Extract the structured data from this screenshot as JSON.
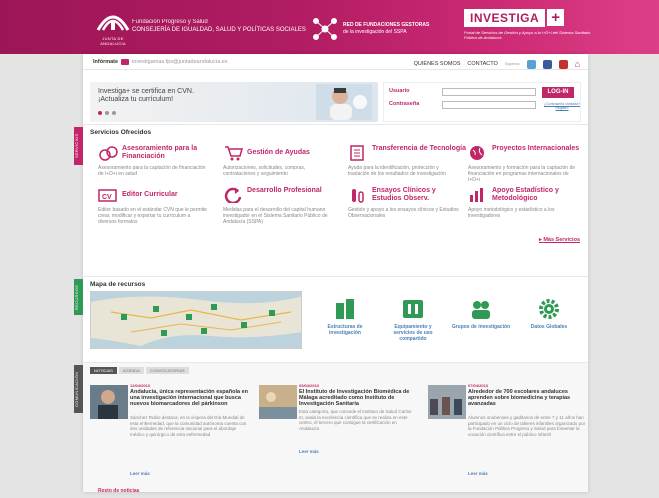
{
  "header": {
    "logo_caption": "JUNTA DE ANDALUCIA",
    "org_line1": "Fundación Progreso y Salud",
    "org_line2": "CONSEJERÍA DE IGUALDAD, SALUD Y POLÍTICAS SOCIALES",
    "red_line1": "RED DE FUNDACIONES GESTORAS",
    "red_line2": "de la investigación del SSPA",
    "brand": "INVESTIGA",
    "brand_plus": "+",
    "brand_sub": "Portal de Servicios de Gestión y Apoyo a la I+D+i del Sistema Sanitario Público de Andalucía"
  },
  "topbar": {
    "info_label": "Infórmate",
    "email": "investigamas.fps@juntadeandalucia.es",
    "nav_about": "QUIÉNES SOMOS",
    "nav_contact": "CONTACTO",
    "nav_prefix": "Síguenos"
  },
  "banner": {
    "line1": "Investiga+ se certifica en CVN.",
    "line2": "¡Actualiza tu currículum!"
  },
  "login": {
    "user_label": "Usuario",
    "pass_label": "Contraseña",
    "button": "LOG-IN",
    "forgot": "¿Contraseña olvidada?",
    "register": "Registro"
  },
  "services": {
    "side_tag": "SERVICIOS",
    "title": "Servicios Ofrecidos",
    "items": [
      {
        "title": "Asesoramiento para la Financiación",
        "desc": "Asesoramiento para la captación de financiación de I+D+i en salud"
      },
      {
        "title": "Gestión de Ayudas",
        "desc": "Autorizaciones, solicitudes, compras, contrataciones y seguimiento"
      },
      {
        "title": "Transferencia de Tecnología",
        "desc": "Ayuda para la identificación, protección y traslación de los resultados de investigación"
      },
      {
        "title": "Proyectos Internacionales",
        "desc": "Asesoramiento y formación para la captación de financiación en programas internacionales de I+D+i"
      },
      {
        "title": "Editor Curricular",
        "desc": "Editor basado en el estándar CVN que le permite crear, modificar y exportar tu currículum a diversos formatos"
      },
      {
        "title": "Desarrollo Profesional",
        "desc": "Medidas para el desarrollo del capital humano investigador en el Sistema Sanitario Público de Andalucía (SSPA)"
      },
      {
        "title": "Ensayos Clínicos y Estudios Observ.",
        "desc": "Gestión y apoyo a los ensayos clínicos y Estudios Observacionales"
      },
      {
        "title": "Apoyo Estadístico y Metodológico",
        "desc": "Apoyo metodológico y estadístico a los investigadores"
      }
    ],
    "more": "Más Servicios"
  },
  "resources": {
    "side_tag": "RECURSOS",
    "title": "Mapa de recursos",
    "items": [
      {
        "label": "Estructuras de investigación"
      },
      {
        "label": "Equipamiento y servicios de uso compartido"
      },
      {
        "label": "Grupos de investigación"
      },
      {
        "label": "Datos Globales"
      }
    ]
  },
  "news": {
    "side_tag": "COMUNICACIÓN",
    "tabs": [
      "NOTICIAS",
      "AGENDA",
      "CONVOCATORIAS"
    ],
    "items": [
      {
        "date": "12/04/2013",
        "title": "Andalucía, única representación española en una investigación internacional que busca nuevos biomarcadores del párkinson",
        "text": "Sánchez Rubio destaca, en la víspera del Día Mundial de esta enfermedad, que la comunidad autónoma cuenta con dos unidades de referencia nacional para el abordaje médico y quirúrgico de esta enfermedad",
        "more": "Leer más"
      },
      {
        "date": "09/04/2013",
        "title": "El Instituto de Investigación Biomédica de Málaga acreditado como Instituto de Investigación Sanitaria",
        "text": "Esta categoría, que concede el Instituto de Salud Carlos III, avala la excelencia científica que se realiza en este centro, el tercero que consigue la certificación en Andalucía",
        "more": "Leer más"
      },
      {
        "date": "07/04/2013",
        "title": "Alrededor de 700 escolares andaluces aprenden sobre biomedicina y terapias avanzadas",
        "text": "Alumnos onubenses y gaditanos de entre 7 y 11 años han participado en un ciclo de talleres infantiles organizado por la Fundación Pública Progreso y Salud para fomentar la vocación científica entre el público infantil",
        "more": "Leer más"
      }
    ],
    "rest": "Resto de noticias"
  },
  "colors": {
    "brand": "#c12669",
    "link": "#4a7fb8",
    "green": "#2f9a55"
  }
}
